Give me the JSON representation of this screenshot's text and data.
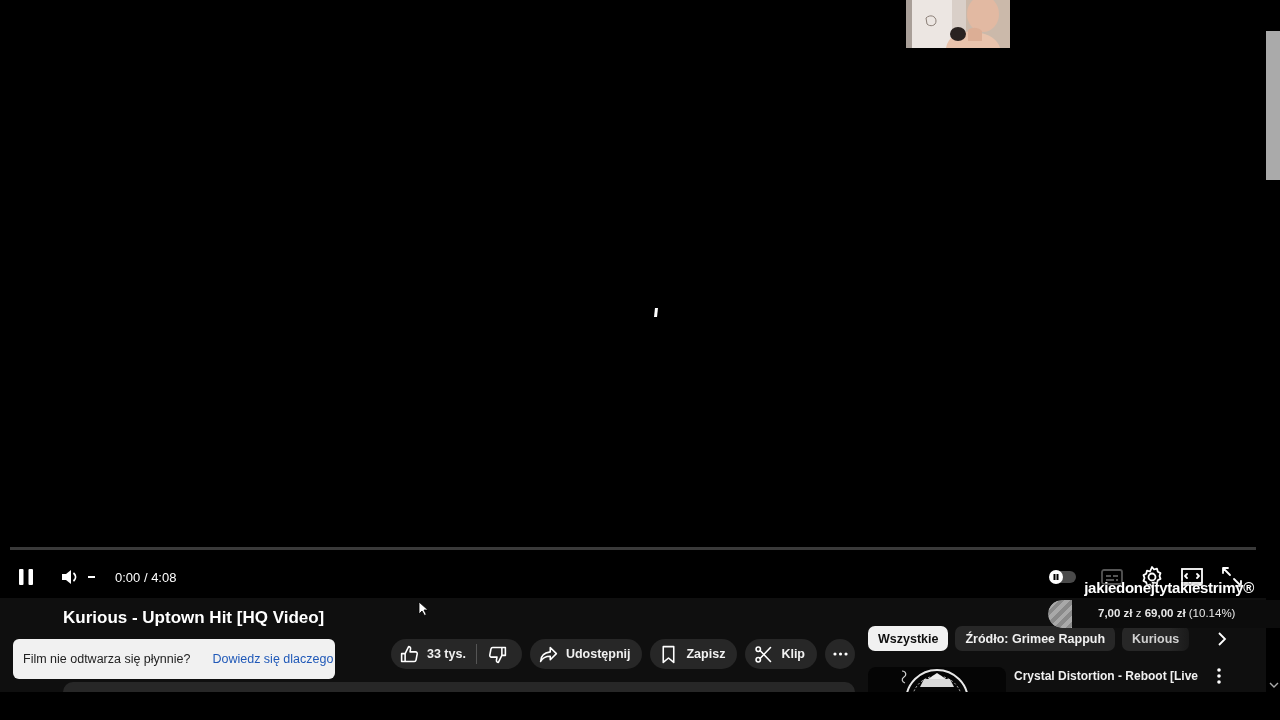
{
  "player": {
    "playing": true,
    "progress": {
      "level": 0
    },
    "time": "0:00 / 4:08",
    "autoplay": {
      "on": false
    },
    "subtitles": {
      "disabled": true
    }
  },
  "video": {
    "title": "Kurious - Uptown Hit [HQ Video]"
  },
  "notice": {
    "text": "Film nie odtwarza się płynnie?",
    "link": "Dowiedz się dlaczego"
  },
  "actions": [
    {
      "kind": "like",
      "label": "33 tys."
    },
    {
      "kind": "dislike"
    },
    {
      "kind": "share",
      "label": "Udostępnij"
    },
    {
      "kind": "save",
      "label": "Zapisz"
    },
    {
      "kind": "clip",
      "label": "Klip"
    },
    {
      "kind": "more"
    }
  ],
  "chips": [
    {
      "label": "Wszystkie",
      "selected": true
    },
    {
      "label": "Źródło: Grimee Rappuh",
      "selected": false
    },
    {
      "label": "Kurious",
      "selected": false
    }
  ],
  "recommendations": [
    {
      "title": "Crystal Distortion - Reboot [Live"
    }
  ],
  "overlay": {
    "channel": "jakiedonejtytakiestrimy®",
    "goal": {
      "text": "**7,00 zł** z **69,00 zł** (10.14%)",
      "level": 0.1014
    }
  }
}
